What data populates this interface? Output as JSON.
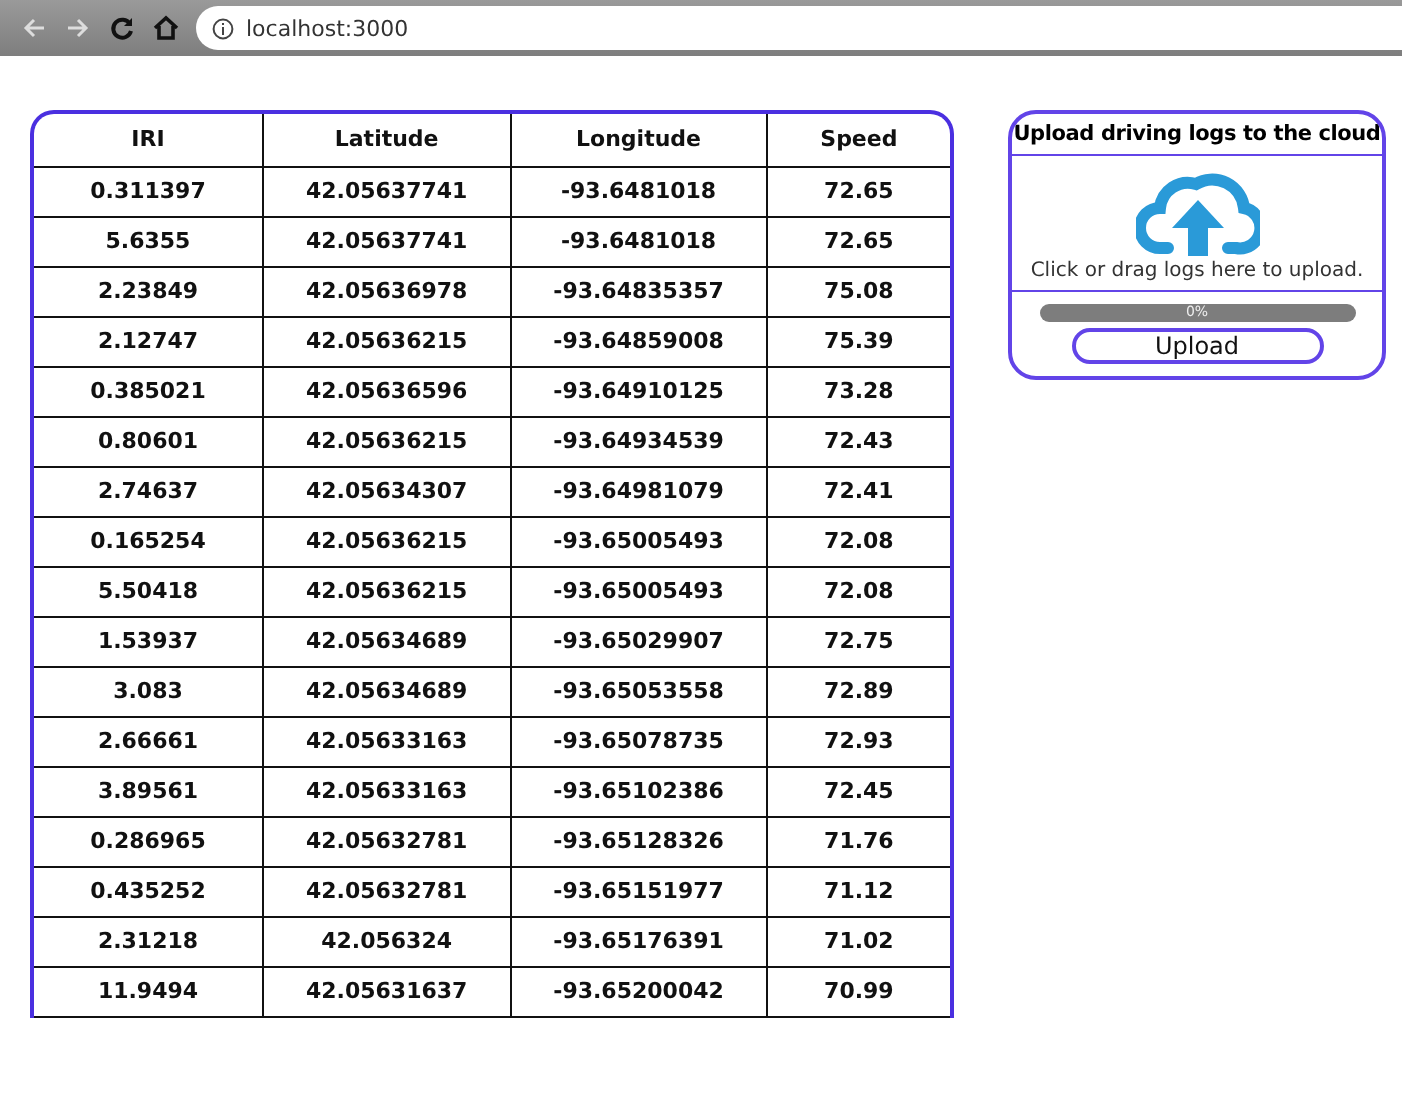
{
  "browser": {
    "url": "localhost:3000"
  },
  "table": {
    "columns": [
      "IRI",
      "Latitude",
      "Longitude",
      "Speed"
    ],
    "rows": [
      [
        "0.311397",
        "42.05637741",
        "-93.6481018",
        "72.65"
      ],
      [
        "5.6355",
        "42.05637741",
        "-93.6481018",
        "72.65"
      ],
      [
        "2.23849",
        "42.05636978",
        "-93.64835357",
        "75.08"
      ],
      [
        "2.12747",
        "42.05636215",
        "-93.64859008",
        "75.39"
      ],
      [
        "0.385021",
        "42.05636596",
        "-93.64910125",
        "73.28"
      ],
      [
        "0.80601",
        "42.05636215",
        "-93.64934539",
        "72.43"
      ],
      [
        "2.74637",
        "42.05634307",
        "-93.64981079",
        "72.41"
      ],
      [
        "0.165254",
        "42.05636215",
        "-93.65005493",
        "72.08"
      ],
      [
        "5.50418",
        "42.05636215",
        "-93.65005493",
        "72.08"
      ],
      [
        "1.53937",
        "42.05634689",
        "-93.65029907",
        "72.75"
      ],
      [
        "3.083",
        "42.05634689",
        "-93.65053558",
        "72.89"
      ],
      [
        "2.66661",
        "42.05633163",
        "-93.65078735",
        "72.93"
      ],
      [
        "3.89561",
        "42.05633163",
        "-93.65102386",
        "72.45"
      ],
      [
        "0.286965",
        "42.05632781",
        "-93.65128326",
        "71.76"
      ],
      [
        "0.435252",
        "42.05632781",
        "-93.65151977",
        "71.12"
      ],
      [
        "2.31218",
        "42.056324",
        "-93.65176391",
        "71.02"
      ],
      [
        "11.9494",
        "42.05631637",
        "-93.65200042",
        "70.99"
      ]
    ]
  },
  "upload": {
    "title": "Upload driving logs to the cloud",
    "hint": "Click or drag logs here to upload.",
    "progress": {
      "level": 0,
      "reading": "0%"
    },
    "button": "Upload"
  }
}
